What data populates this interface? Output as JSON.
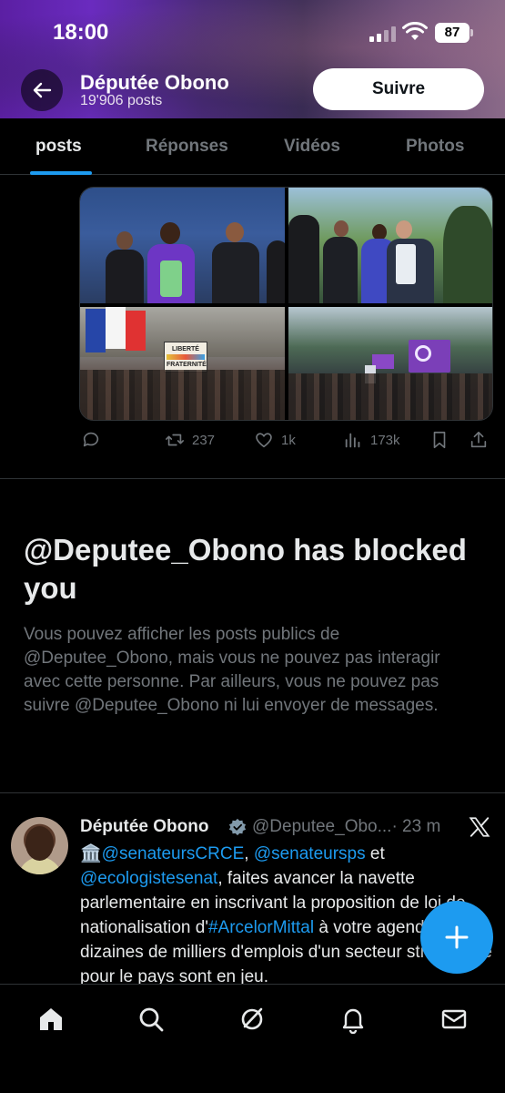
{
  "status_bar": {
    "time": "18:00",
    "battery": "87"
  },
  "header": {
    "title": "Députée Obono",
    "post_count": "19'906 posts",
    "follow_label": "Suivre"
  },
  "tabs": [
    {
      "label": "posts",
      "active": true
    },
    {
      "label": "Réponses",
      "active": false
    },
    {
      "label": "Vidéos",
      "active": false
    },
    {
      "label": "Photos",
      "active": false
    }
  ],
  "media_post": {
    "photo_sign_lines": [
      "LIBERTÉ",
      "FRATERNITÉ"
    ],
    "actions": {
      "retweets": "237",
      "likes": "1k",
      "views": "173k"
    }
  },
  "blocked": {
    "title": "@Deputee_Obono has blocked you",
    "body": "Vous pouvez afficher les posts publics de @Deputee_Obono, mais vous ne pouvez pas interagir avec cette personne. Par ailleurs, vous ne pouvez pas suivre @Deputee_Obono ni lui envoyer de messages."
  },
  "tweet": {
    "name": "Députée Obono",
    "handle": "@Deputee_Obo...",
    "time": "· 23 m",
    "emoji": "🏛️",
    "mention1": "@senateursCRCE",
    "sep1": ", ",
    "mention2": "@senateursps",
    "text1": " et ",
    "mention3": "@ecologistesenat",
    "text2": ", faites avancer la navette parlementaire en inscrivant la proposition de loi de nationalisation d'",
    "hashtag": "#ArcelorMittal",
    "text3": " à votre agenda. Des dizaines de milliers d'emplois d'un secteur stratégique pour le pays sont en jeu."
  },
  "colors": {
    "accent": "#1d9bf0",
    "background": "#000000",
    "muted": "#71767b"
  },
  "icons": {
    "nav": [
      "home-icon",
      "search-icon",
      "grok-icon",
      "notifications-icon",
      "messages-icon"
    ]
  }
}
